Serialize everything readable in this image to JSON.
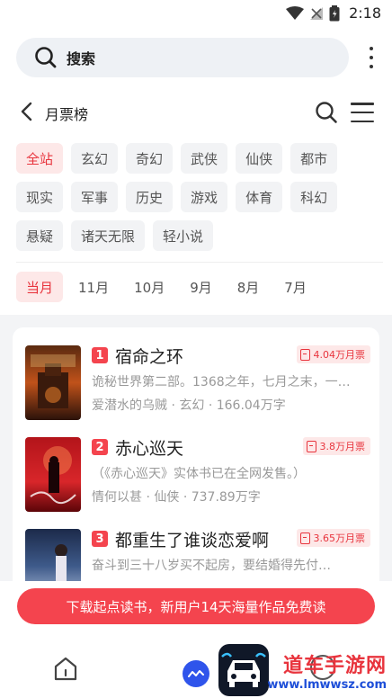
{
  "status_bar": {
    "time": "2:18"
  },
  "search": {
    "label": "搜索"
  },
  "header": {
    "title": "月票榜"
  },
  "categories": [
    [
      "全站",
      "玄幻",
      "奇幻",
      "武侠",
      "仙侠",
      "都市"
    ],
    [
      "现实",
      "军事",
      "历史",
      "游戏",
      "体育",
      "科幻"
    ],
    [
      "悬疑",
      "诸天无限",
      "轻小说"
    ]
  ],
  "active_category": "全站",
  "months": [
    "当月",
    "11月",
    "10月",
    "9月",
    "8月",
    "7月"
  ],
  "active_month": "当月",
  "books": [
    {
      "rank": "1",
      "title": "宿命之环",
      "tickets": "4.04万月票",
      "desc": "诡秘世界第二部。1368之年，七月之末，一…",
      "author": "爱潜水的乌贼",
      "genre": "玄幻",
      "words": "166.04万字"
    },
    {
      "rank": "2",
      "title": "赤心巡天",
      "tickets": "3.8万月票",
      "desc": "（《赤心巡天》实体书已在全网发售。）",
      "author": "情何以甚",
      "genre": "仙侠",
      "words": "737.89万字"
    },
    {
      "rank": "3",
      "title": "都重生了谁谈恋爱啊",
      "tickets": "3.65万月票",
      "desc": "奋斗到三十八岁买不起房，要结婚得先付…",
      "author": "",
      "genre": "",
      "words": ""
    }
  ],
  "meta_separator": "·",
  "promo": {
    "text": "下载起点读书，新用户14天海量作品免费读"
  },
  "watermark": {
    "main": "道车手游网",
    "sub": "www.lmwwsz.com"
  },
  "colors": {
    "accent": "#e8343d",
    "accent_bg": "#fde8e8",
    "chip_bg": "#f2f3f5",
    "list_bg": "#f3f4f6"
  }
}
